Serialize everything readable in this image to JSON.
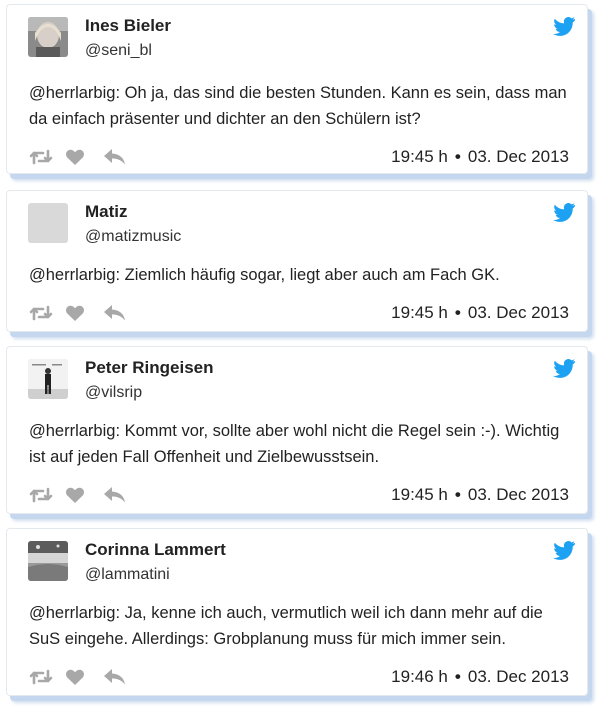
{
  "colors": {
    "twitter_blue": "#1da1f2",
    "action_gray": "#a8a8a8",
    "card_shadow": "#c4d7ee"
  },
  "icons": {
    "brand": "twitter-bird-icon",
    "retweet": "retweet-icon",
    "like": "heart-icon",
    "reply": "reply-icon"
  },
  "tweets": [
    {
      "name": "Ines Bieler",
      "handle": "@seni_bl",
      "text_lines": [
        "@herrlarbig: Oh ja, das sind die besten Stunden. Kann es sein, dass man",
        "da einfach präsenter und dichter an den Schülern ist?"
      ],
      "time": "19:45 h",
      "separator": "•",
      "date": "03. Dec 2013"
    },
    {
      "name": "Matiz",
      "handle": "@matizmusic",
      "text_lines": [
        "@herrlarbig: Ziemlich häufig sogar, liegt aber auch am Fach GK."
      ],
      "time": "19:45 h",
      "separator": "•",
      "date": "03. Dec 2013"
    },
    {
      "name": "Peter Ringeisen",
      "handle": "@vilsrip",
      "text_lines": [
        "@herrlarbig: Kommt vor, sollte aber wohl nicht die Regel sein :-). Wichtig",
        "ist auf jeden Fall Offenheit und Zielbewusstsein."
      ],
      "time": "19:45 h",
      "separator": "•",
      "date": "03. Dec 2013"
    },
    {
      "name": "Corinna Lammert",
      "handle": "@lammatini",
      "text_lines": [
        "@herrlarbig: Ja, kenne ich auch, vermutlich weil ich dann mehr auf die",
        "SuS eingehe. Allerdings: Grobplanung muss für mich immer sein."
      ],
      "time": "19:46 h",
      "separator": "•",
      "date": "03. Dec 2013"
    }
  ]
}
